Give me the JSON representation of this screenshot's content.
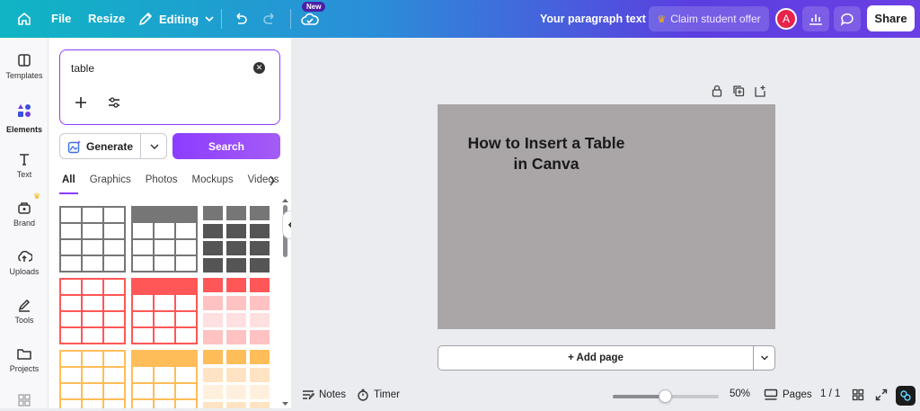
{
  "topbar": {
    "file_label": "File",
    "resize_label": "Resize",
    "editing_label": "Editing",
    "new_badge": "New",
    "doc_title": "Your paragraph text",
    "claim_label": "Claim student offer",
    "avatar_letter": "A",
    "share_label": "Share"
  },
  "rail": {
    "items": [
      {
        "label": "Templates",
        "icon": "templates-icon"
      },
      {
        "label": "Elements",
        "icon": "elements-icon"
      },
      {
        "label": "Text",
        "icon": "text-icon"
      },
      {
        "label": "Brand",
        "icon": "brand-icon"
      },
      {
        "label": "Uploads",
        "icon": "uploads-icon"
      },
      {
        "label": "Tools",
        "icon": "tools-icon"
      },
      {
        "label": "Projects",
        "icon": "projects-icon"
      }
    ]
  },
  "panel": {
    "search_value": "table",
    "generate_label": "Generate",
    "search_button_label": "Search",
    "tabs": [
      "All",
      "Graphics",
      "Photos",
      "Mockups",
      "Videos"
    ]
  },
  "canvas": {
    "title_line1": "How to Insert a Table",
    "title_line2": "in Canva",
    "add_page_label": "+ Add page"
  },
  "footer": {
    "notes_label": "Notes",
    "timer_label": "Timer",
    "zoom_label": "50%",
    "zoom_fraction": 0.5,
    "pages_label": "Pages",
    "page_count": "1 / 1"
  },
  "colors": {
    "accent": "#8b3dff",
    "canvas_bg": "#aaa5a6",
    "table_gray": "#767676",
    "table_dark": "#555555",
    "table_red": "#ff5757",
    "table_red_light": "#ffc2c2",
    "table_orange": "#ffbd59",
    "table_orange_light": "#ffe3c2"
  }
}
